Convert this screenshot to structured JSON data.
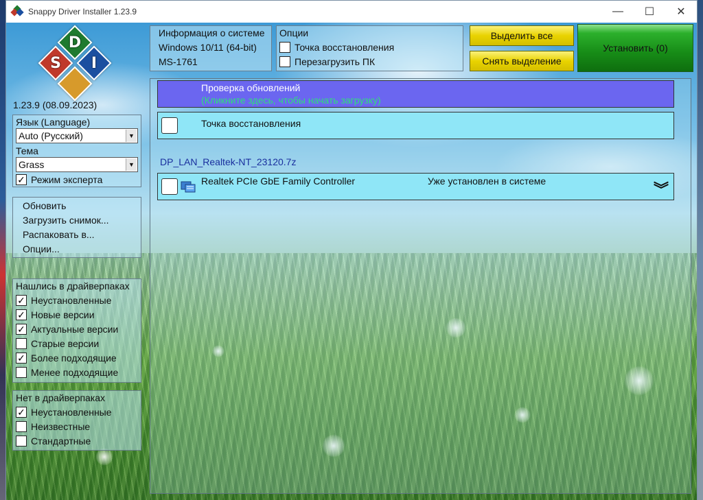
{
  "window": {
    "title": "Snappy Driver Installer 1.23.9",
    "minimize_glyph": "—",
    "maximize_glyph": "☐",
    "close_glyph": "✕"
  },
  "logo": {
    "letters": {
      "top": "D",
      "left": "S",
      "right": "I"
    },
    "colors": {
      "top": "#1f7a2e",
      "left": "#c0392b",
      "right": "#1b4fa0",
      "bottom": "#d79a2b"
    }
  },
  "version": "1.23.9 (08.09.2023)",
  "settings": {
    "language_label": "Язык (Language)",
    "language_value": "Auto (Русский)",
    "theme_label": "Тема",
    "theme_value": "Grass",
    "expert_mode_label": "Режим эксперта",
    "expert_mode_checked": true
  },
  "menu": {
    "items": [
      "Обновить",
      "Загрузить снимок...",
      "Распаковать в...",
      "Опции..."
    ]
  },
  "found_filters": {
    "title": "Нашлись в драйверпаках",
    "items": [
      {
        "label": "Неустановленные",
        "checked": true
      },
      {
        "label": "Новые версии",
        "checked": true
      },
      {
        "label": "Актуальные версии",
        "checked": true
      },
      {
        "label": "Старые версии",
        "checked": false
      },
      {
        "label": "Более подходящие",
        "checked": true
      },
      {
        "label": "Менее подходящие",
        "checked": false
      }
    ]
  },
  "notfound_filters": {
    "title": "Нет в драйверпаках",
    "items": [
      {
        "label": "Неустановленные",
        "checked": true
      },
      {
        "label": "Неизвестные",
        "checked": false
      },
      {
        "label": "Стандартные",
        "checked": false
      }
    ]
  },
  "sysinfo": {
    "title": "Информация о системе",
    "os": "Windows 10/11 (64-bit)",
    "model": "MS-1761"
  },
  "options": {
    "title": "Опции",
    "restore_point_label": "Точка восстановления",
    "restore_point_checked": false,
    "reboot_label": "Перезагрузить ПК",
    "reboot_checked": false
  },
  "actions": {
    "select_all": "Выделить все",
    "deselect": "Снять выделение",
    "install": "Установить (0)"
  },
  "content": {
    "update_check_title": "Проверка обновлений",
    "update_check_hint": "(Кликните здесь, чтобы начать загрузку)",
    "restore_point_row": "Точка восстановления",
    "driverpack_name": "DP_LAN_Realtek-NT_23120.7z",
    "device_name": "Realtek PCIe GbE Family Controller",
    "device_status": "Уже установлен в системе",
    "expand_glyph": "︾"
  },
  "colors": {
    "update_bar": "#6b66f0",
    "update_hint": "#2ee07a",
    "driver_row": "#8fe6f7",
    "driverpack_link": "#1a2f9e"
  }
}
